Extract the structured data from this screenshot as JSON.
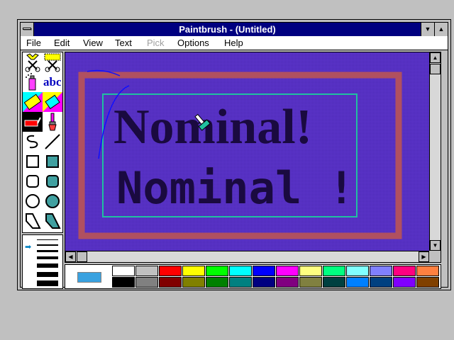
{
  "window": {
    "title": "Paintbrush - (Untitled)"
  },
  "menu": [
    {
      "label": "File",
      "disabled": false
    },
    {
      "label": "Edit",
      "disabled": false
    },
    {
      "label": "View",
      "disabled": false
    },
    {
      "label": "Text",
      "disabled": false
    },
    {
      "label": "Pick",
      "disabled": true
    },
    {
      "label": "Options",
      "disabled": false
    },
    {
      "label": "Help",
      "disabled": false
    }
  ],
  "tools": [
    "scissors-tool",
    "pick-tool",
    "airbrush-tool",
    "text-tool",
    "color-eraser-tool",
    "eraser-tool",
    "paint-roller-tool",
    "brush-tool",
    "curve-tool",
    "line-tool",
    "box-tool",
    "filled-box-tool",
    "rounded-box-tool",
    "filled-rounded-box-tool",
    "circle-tool",
    "filled-circle-tool",
    "polygon-tool",
    "filled-polygon-tool"
  ],
  "text_tool_label": "abc",
  "canvas": {
    "background": "#5a33c8",
    "text_line1": "Nominal!",
    "text_line2": "Nominal !"
  },
  "palette": {
    "selected_foreground": "#3aa2e0",
    "colors_top": [
      "#ffffff",
      "#c0c0c0",
      "#ff0000",
      "#ffff00",
      "#00ff00",
      "#00ffff",
      "#0000ff",
      "#ff00ff",
      "#ffff80",
      "#00ff80",
      "#80ffff",
      "#8080ff",
      "#ff0080",
      "#ff8040"
    ],
    "colors_bottom": [
      "#000000",
      "#808080",
      "#800000",
      "#808000",
      "#008000",
      "#008080",
      "#000080",
      "#800080",
      "#808040",
      "#004040",
      "#0080ff",
      "#004080",
      "#8000ff",
      "#804000"
    ]
  }
}
